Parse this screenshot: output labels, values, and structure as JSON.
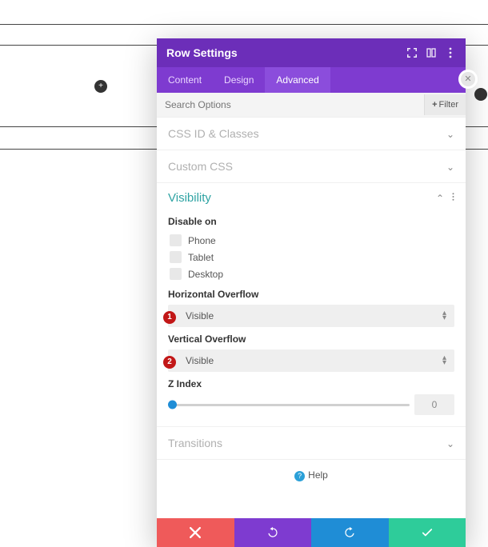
{
  "titlebar": {
    "title": "Row Settings"
  },
  "tabs": [
    {
      "label": "Content",
      "active": false
    },
    {
      "label": "Design",
      "active": false
    },
    {
      "label": "Advanced",
      "active": true
    }
  ],
  "search": {
    "placeholder": "Search Options",
    "filter_label": "Filter"
  },
  "sections": {
    "css": {
      "title": "CSS ID & Classes"
    },
    "custom_css": {
      "title": "Custom CSS"
    },
    "visibility": {
      "title": "Visibility",
      "disable_on_label": "Disable on",
      "options": [
        {
          "label": "Phone"
        },
        {
          "label": "Tablet"
        },
        {
          "label": "Desktop"
        }
      ],
      "h_overflow": {
        "label": "Horizontal Overflow",
        "value": "Visible",
        "badge": "1"
      },
      "v_overflow": {
        "label": "Vertical Overflow",
        "value": "Visible",
        "badge": "2"
      },
      "z_index": {
        "label": "Z Index",
        "value": "0"
      }
    },
    "transitions": {
      "title": "Transitions"
    }
  },
  "help": {
    "label": "Help"
  }
}
